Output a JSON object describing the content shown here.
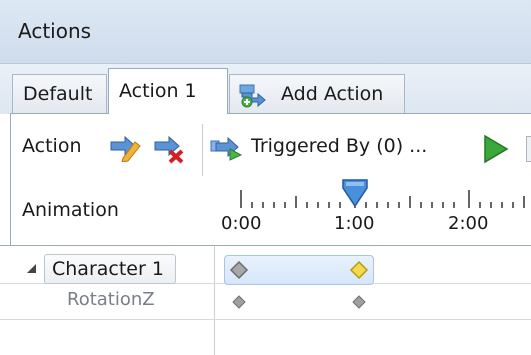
{
  "panel": {
    "title": "Actions"
  },
  "tabs": [
    {
      "label": "Default"
    },
    {
      "label": "Action 1"
    },
    {
      "label": "Add Action",
      "icon": "add-action-icon"
    }
  ],
  "toolbar": {
    "action_label": "Action",
    "triggered_label": "Triggered By (0) ...",
    "animation_label": "Animation",
    "icons": [
      "edit-action-icon",
      "delete-action-icon",
      "triggered-by-icon",
      "play-icon"
    ]
  },
  "ruler": {
    "ticks": [
      "0:00",
      "1:00",
      "2:00"
    ],
    "playhead": "1:00"
  },
  "tracks": {
    "character_label": "Character 1",
    "property_label": "RotationZ"
  },
  "colors": {
    "header_bg": "#d4e0ee",
    "key_selected": "#f5d94a",
    "key_normal": "#a0a0a0",
    "play_green": "#3aa83a"
  }
}
